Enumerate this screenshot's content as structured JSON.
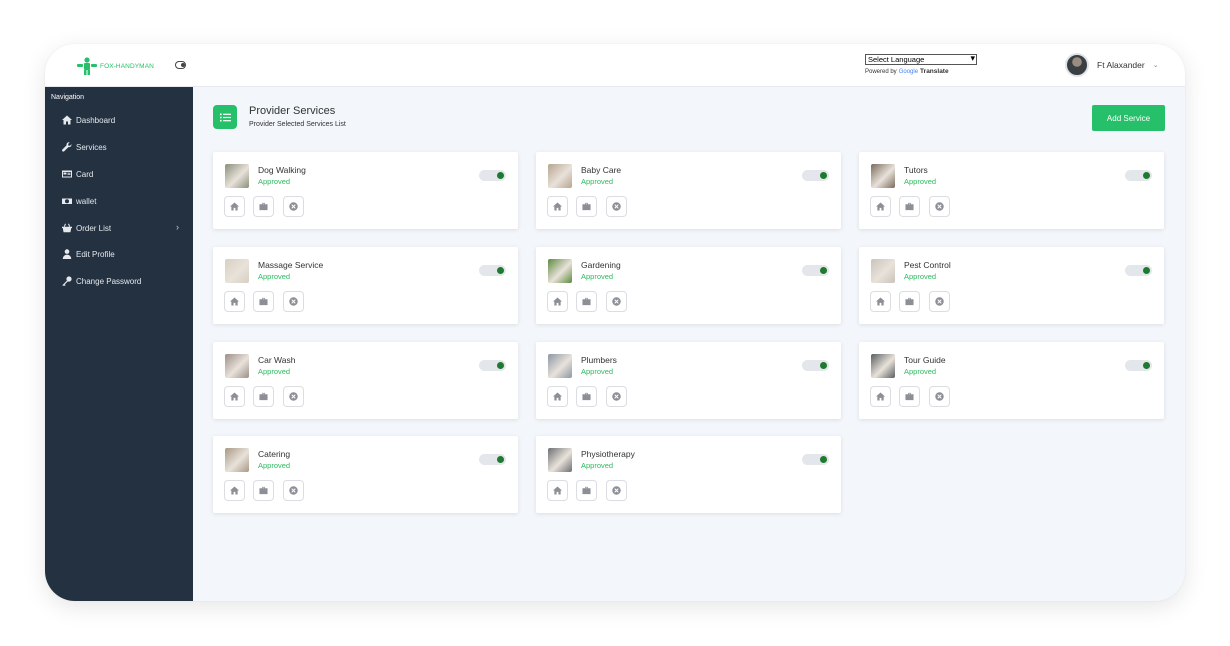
{
  "header": {
    "logo_text": "FOX-HANDYMAN",
    "language_select": "Select Language",
    "powered_by": "Powered by",
    "google": "Google",
    "translate": "Translate",
    "user_name": "Ft Alaxander"
  },
  "sidebar": {
    "title": "Navigation",
    "items": [
      {
        "label": "Dashboard",
        "icon": "home-icon"
      },
      {
        "label": "Services",
        "icon": "wrench-icon"
      },
      {
        "label": "Card",
        "icon": "card-icon"
      },
      {
        "label": "wallet",
        "icon": "wallet-icon"
      },
      {
        "label": "Order List",
        "icon": "basket-icon"
      },
      {
        "label": "Edit Profile",
        "icon": "user-icon"
      },
      {
        "label": "Change Password",
        "icon": "key-icon"
      }
    ]
  },
  "page": {
    "title": "Provider Services",
    "subtitle": "Provider Selected Services List",
    "add_button": "Add Service"
  },
  "services": [
    {
      "name": "Dog Walking",
      "status": "Approved",
      "enabled": true,
      "thumb_color": "#8a8f7a"
    },
    {
      "name": "Baby Care",
      "status": "Approved",
      "enabled": true,
      "thumb_color": "#b8a48f"
    },
    {
      "name": "Tutors",
      "status": "Approved",
      "enabled": true,
      "thumb_color": "#7b6a5c"
    },
    {
      "name": "Massage Service",
      "status": "Approved",
      "enabled": true,
      "thumb_color": "#d9cfc2"
    },
    {
      "name": "Gardening",
      "status": "Approved",
      "enabled": true,
      "thumb_color": "#5d8a3c"
    },
    {
      "name": "Pest Control",
      "status": "Approved",
      "enabled": true,
      "thumb_color": "#c9c3bb"
    },
    {
      "name": "Car Wash",
      "status": "Approved",
      "enabled": true,
      "thumb_color": "#9c8f88"
    },
    {
      "name": "Plumbers",
      "status": "Approved",
      "enabled": true,
      "thumb_color": "#8d96a3"
    },
    {
      "name": "Tour Guide",
      "status": "Approved",
      "enabled": true,
      "thumb_color": "#5a5d61"
    },
    {
      "name": "Catering",
      "status": "Approved",
      "enabled": true,
      "thumb_color": "#a99884"
    },
    {
      "name": "Physiotherapy",
      "status": "Approved",
      "enabled": true,
      "thumb_color": "#6d6f73"
    }
  ],
  "colors": {
    "accent": "#27c06a",
    "sidebar_bg": "#243140",
    "approved": "#2dbb5f"
  }
}
